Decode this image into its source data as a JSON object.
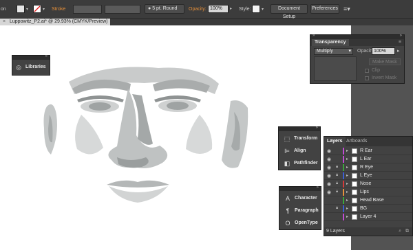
{
  "control_bar": {
    "stroke_label": "Stroke",
    "stroke_profile": "5 pt. Round",
    "opacity_label": "Opacity:",
    "opacity_value": "100%",
    "style_label": "Style:",
    "document_setup": "Document Setup",
    "preferences": "Preferences"
  },
  "document_tab": {
    "title": "Luppowitz_P2.ai* @ 29.93% (CMYK/Preview)"
  },
  "libraries_panel": {
    "label": "Libraries"
  },
  "transparency_panel": {
    "title": "Transparency",
    "blend_mode": "Multiply",
    "opacity_label": "Opacity:",
    "opacity_value": "100%",
    "make_mask": "Make Mask",
    "clip": "Clip",
    "invert_mask": "Invert Mask"
  },
  "transform_panel": {
    "items": [
      "Transform",
      "Align",
      "Pathfinder"
    ]
  },
  "type_panel": {
    "items": [
      "Character",
      "Paragraph",
      "OpenType"
    ]
  },
  "layers_panel": {
    "tabs": [
      "Layers",
      "Artboards"
    ],
    "rows": [
      {
        "name": "R Ear",
        "color": "#c24ad6",
        "locked": false,
        "visible": true
      },
      {
        "name": "L Ear",
        "color": "#c24ad6",
        "locked": false,
        "visible": true
      },
      {
        "name": "R Eye",
        "color": "#3aa83a",
        "locked": true,
        "visible": true
      },
      {
        "name": "L Eye",
        "color": "#3a5fd6",
        "locked": true,
        "visible": true
      },
      {
        "name": "Nose",
        "color": "#d63a3a",
        "locked": true,
        "visible": true
      },
      {
        "name": "Lips",
        "color": "#e8913a",
        "locked": true,
        "visible": true
      },
      {
        "name": "Head Base",
        "color": "#3aa83a",
        "locked": false,
        "visible": false
      },
      {
        "name": "BG",
        "color": "#3a5fd6",
        "locked": true,
        "visible": false
      },
      {
        "name": "Layer 4",
        "color": "#c24ad6",
        "locked": false,
        "visible": false
      }
    ],
    "count": "9 Layers"
  }
}
